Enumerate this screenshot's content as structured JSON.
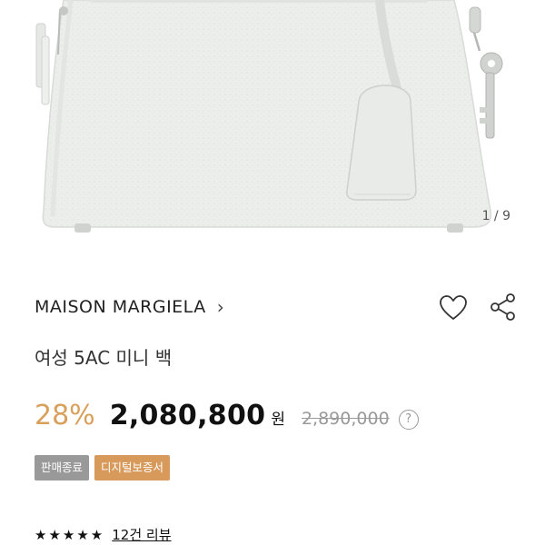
{
  "gallery": {
    "pager": "1 / 9"
  },
  "brand": {
    "name": "MAISON MARGIELA",
    "chevron": "›"
  },
  "product": {
    "name": "여성 5AC 미니 백"
  },
  "price": {
    "discount": "28%",
    "current": "2,080,800",
    "currency": "원",
    "original": "2,890,000",
    "info_glyph": "?"
  },
  "badges": [
    {
      "label": "판매종료",
      "color": "#999999"
    },
    {
      "label": "디지털보증서",
      "color": "#d89a5b"
    }
  ],
  "rating": {
    "stars": "★★★★★",
    "reviews": "12건 리뷰",
    "score": 5
  },
  "icons": {
    "wishlist": "heart-icon",
    "share": "share-icon"
  },
  "colors": {
    "accent": "#d8a05a",
    "bag": "#eceeec"
  }
}
